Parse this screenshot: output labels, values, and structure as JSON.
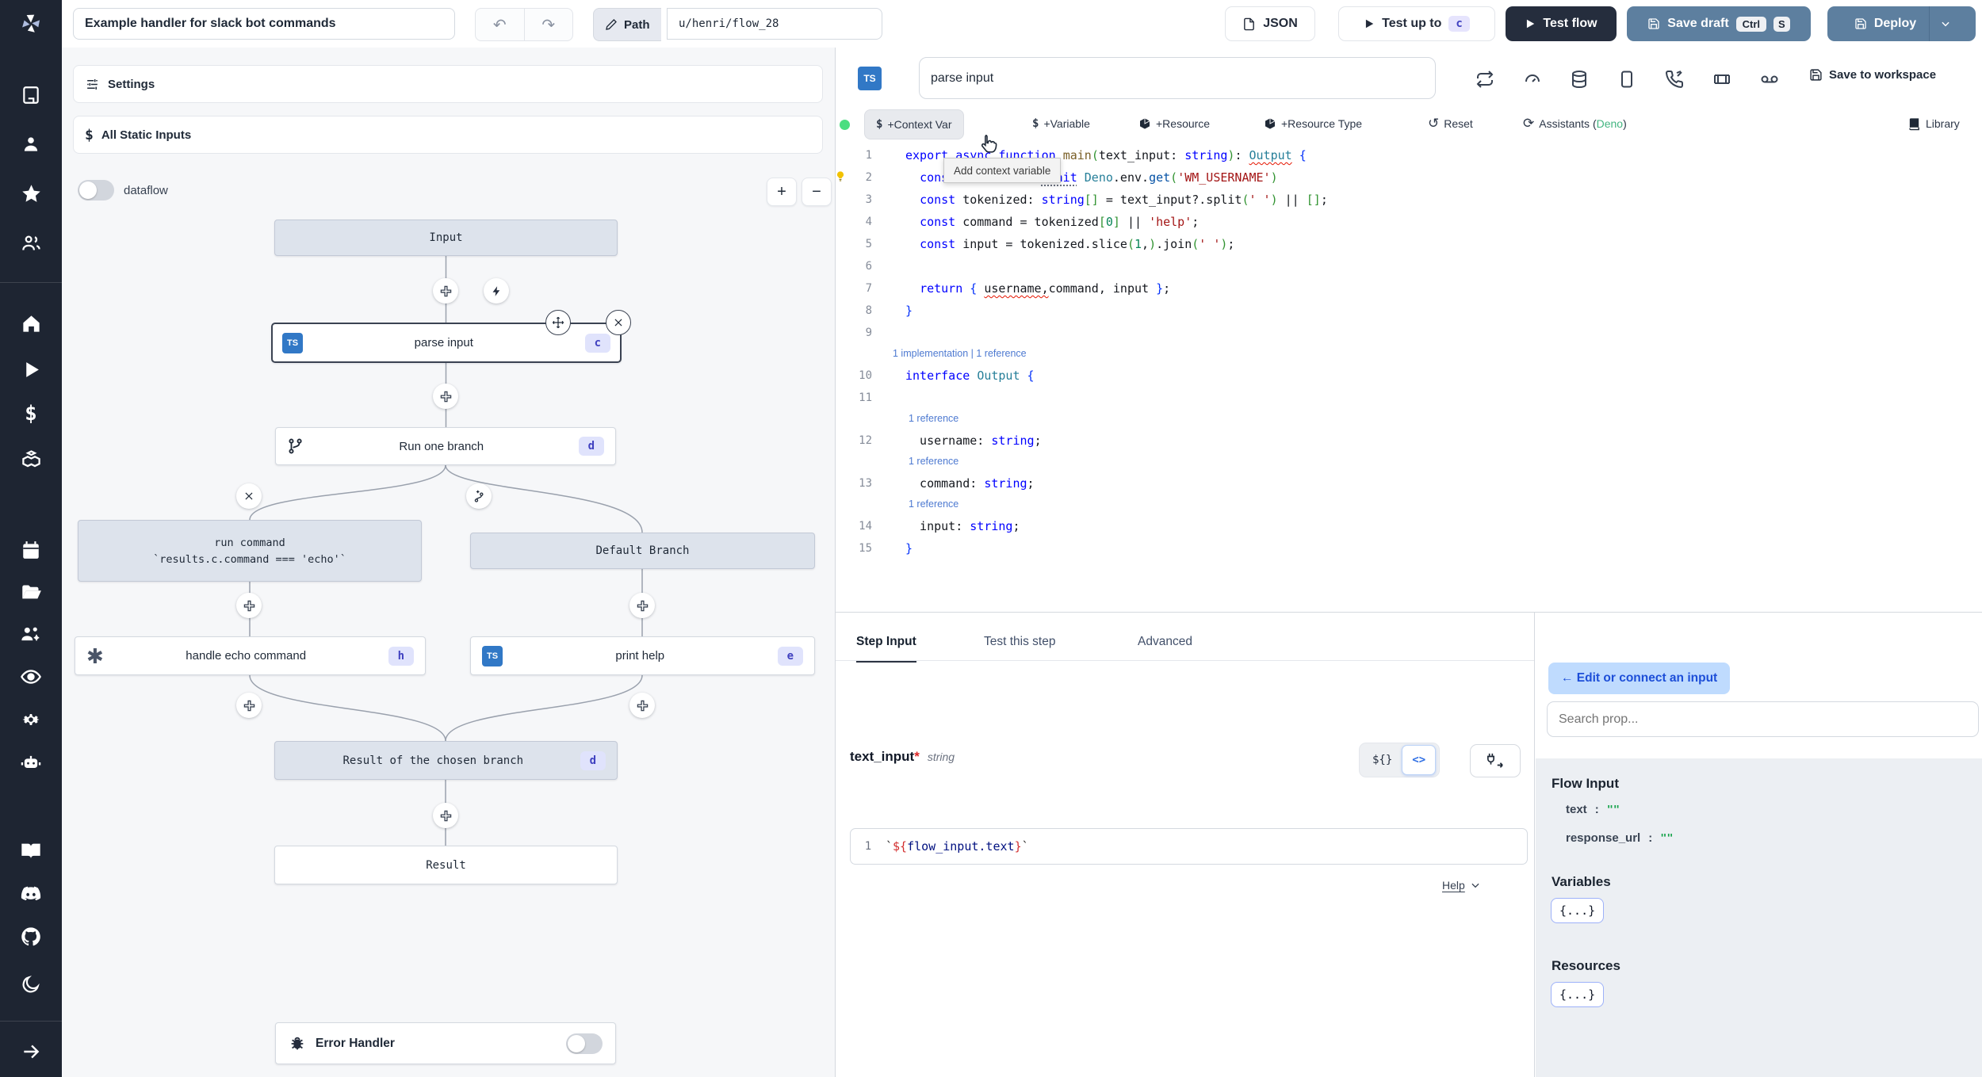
{
  "topbar": {
    "title_value": "Example handler for slack bot commands",
    "undo_icon": "↶",
    "redo_icon": "↷",
    "path_label": "Path",
    "path_value": "u/henri/flow_28",
    "json_label": "JSON",
    "test_up_to_label": "Test up to",
    "test_up_to_step": "c",
    "test_flow_label": "Test flow",
    "save_draft_label": "Save draft",
    "kbd_ctrl": "Ctrl",
    "kbd_s": "S",
    "deploy_label": "Deploy"
  },
  "left_panel": {
    "settings": "Settings",
    "all_static_inputs": "All Static Inputs",
    "dataflow": "dataflow",
    "zoom_in": "+",
    "zoom_out": "−"
  },
  "graph": {
    "nodes": {
      "input": {
        "label": "Input"
      },
      "parse": {
        "label": "parse input",
        "badge": "c",
        "lang": "TS"
      },
      "branch": {
        "label": "Run one branch",
        "badge": "d"
      },
      "run_command": {
        "line1": "run command",
        "line2": "`results.c.command === 'echo'`"
      },
      "default_branch": {
        "label": "Default Branch"
      },
      "handle_echo": {
        "label": "handle echo command",
        "badge": "h",
        "icon_glyph": "✱"
      },
      "print_help": {
        "label": "print help",
        "badge": "e",
        "lang": "TS"
      },
      "result_chosen": {
        "label": "Result of the chosen branch",
        "badge": "d"
      },
      "result": {
        "label": "Result"
      },
      "error_handler": {
        "label": "Error Handler"
      }
    }
  },
  "editor": {
    "step_name": "parse input",
    "save_to_workspace": "Save to workspace",
    "library": "Library",
    "actions": {
      "context_var": "+Context Var",
      "variable": "+Variable",
      "resource": "+Resource",
      "resource_type": "+Resource Type",
      "reset": "Reset",
      "assistants_prefix": "Assistants (",
      "assistants_lang": "Deno",
      "assistants_suffix": ")",
      "dollar_glyph": "$",
      "reset_glyph": "↺",
      "assist_glyph": "⟳"
    },
    "tooltip": "Add context variable",
    "code": [
      {
        "t": "line",
        "n": "1",
        "tokens": [
          [
            "kw",
            "export"
          ],
          [
            "pl",
            " "
          ],
          [
            "kw",
            "async"
          ],
          [
            "pl",
            " "
          ],
          [
            "kw",
            "function"
          ],
          [
            "pl",
            " "
          ],
          [
            "fn",
            "main"
          ],
          [
            "br2",
            "("
          ],
          [
            "pl",
            "text_input"
          ],
          [
            "pl",
            ": "
          ],
          [
            "kw",
            "string"
          ],
          [
            "br2",
            ")"
          ],
          [
            "pl",
            ": "
          ],
          [
            "type sq",
            "Output"
          ],
          [
            "pl",
            " "
          ],
          [
            "br1",
            "{"
          ]
        ]
      },
      {
        "t": "line",
        "n": "2",
        "bulb": true,
        "tokens": [
          [
            "pl",
            "  "
          ],
          [
            "kw",
            "const"
          ],
          [
            "pl",
            " username = "
          ],
          [
            "kw dotted",
            "await"
          ],
          [
            "pl",
            " "
          ],
          [
            "type",
            "Deno"
          ],
          [
            "pl",
            ".env."
          ],
          [
            "mem",
            "get"
          ],
          [
            "br2",
            "("
          ],
          [
            "str",
            "'WM_USERNAME'"
          ],
          [
            "br2",
            ")"
          ]
        ]
      },
      {
        "t": "line",
        "n": "3",
        "tokens": [
          [
            "pl",
            "  "
          ],
          [
            "kw",
            "const"
          ],
          [
            "pl",
            " tokenized: "
          ],
          [
            "kw",
            "string"
          ],
          [
            "br2",
            "[]"
          ],
          [
            "pl",
            " = text_input?.split"
          ],
          [
            "br2",
            "("
          ],
          [
            "str",
            "' '"
          ],
          [
            "br2",
            ")"
          ],
          [
            "pl",
            " || "
          ],
          [
            "br2",
            "[]"
          ],
          [
            "pl",
            ";"
          ]
        ]
      },
      {
        "t": "line",
        "n": "4",
        "tokens": [
          [
            "pl",
            "  "
          ],
          [
            "kw",
            "const"
          ],
          [
            "pl",
            " command = tokenized"
          ],
          [
            "br2",
            "["
          ],
          [
            "num",
            "0"
          ],
          [
            "br2",
            "]"
          ],
          [
            "pl",
            " || "
          ],
          [
            "str",
            "'help'"
          ],
          [
            "pl",
            ";"
          ]
        ]
      },
      {
        "t": "line",
        "n": "5",
        "tokens": [
          [
            "pl",
            "  "
          ],
          [
            "kw",
            "const"
          ],
          [
            "pl",
            " input = tokenized.slice"
          ],
          [
            "br2",
            "("
          ],
          [
            "num",
            "1"
          ],
          [
            "pl",
            ","
          ],
          [
            "br2",
            ")"
          ],
          [
            "pl",
            ".join"
          ],
          [
            "br2",
            "("
          ],
          [
            "str",
            "' '"
          ],
          [
            "br2",
            ")"
          ],
          [
            "pl",
            ";"
          ]
        ]
      },
      {
        "t": "line",
        "n": "6",
        "tokens": []
      },
      {
        "t": "line",
        "n": "7",
        "tokens": [
          [
            "pl",
            "  "
          ],
          [
            "kw",
            "return"
          ],
          [
            "pl",
            " "
          ],
          [
            "br1",
            "{"
          ],
          [
            "pl",
            " "
          ],
          [
            "pl sq",
            "username,"
          ],
          [
            "pl",
            "command, input "
          ],
          [
            "br1",
            "}"
          ],
          [
            "pl",
            ";"
          ]
        ]
      },
      {
        "t": "line",
        "n": "8",
        "tokens": [
          [
            "br1",
            "}"
          ]
        ]
      },
      {
        "t": "line",
        "n": "9",
        "tokens": []
      },
      {
        "t": "lens",
        "ind": 0,
        "text": "1 implementation | 1 reference"
      },
      {
        "t": "line",
        "n": "10",
        "tokens": [
          [
            "kw",
            "interface"
          ],
          [
            "pl",
            " "
          ],
          [
            "type",
            "Output"
          ],
          [
            "pl",
            " "
          ],
          [
            "br1",
            "{"
          ]
        ]
      },
      {
        "t": "line",
        "n": "11",
        "tokens": []
      },
      {
        "t": "lens",
        "ind": 1,
        "text": "1 reference"
      },
      {
        "t": "line",
        "n": "12",
        "tokens": [
          [
            "pl",
            "  username: "
          ],
          [
            "kw",
            "string"
          ],
          [
            "pl",
            ";"
          ]
        ]
      },
      {
        "t": "lens",
        "ind": 1,
        "text": "1 reference"
      },
      {
        "t": "line",
        "n": "13",
        "tokens": [
          [
            "pl",
            "  command: "
          ],
          [
            "kw",
            "string"
          ],
          [
            "pl",
            ";"
          ]
        ]
      },
      {
        "t": "lens",
        "ind": 1,
        "text": "1 reference"
      },
      {
        "t": "line",
        "n": "14",
        "tokens": [
          [
            "pl",
            "  input: "
          ],
          [
            "kw",
            "string"
          ],
          [
            "pl",
            ";"
          ]
        ]
      },
      {
        "t": "line",
        "n": "15",
        "tokens": [
          [
            "br1",
            "}"
          ]
        ]
      }
    ]
  },
  "step_panel": {
    "tabs": [
      "Step Input",
      "Test this step",
      "Advanced"
    ],
    "field": "text_input",
    "required": "*",
    "type": "string",
    "toggle_expr": "${}",
    "toggle_code": "<>",
    "expr_line_no": "1",
    "expr_tokens": [
      [
        "tick",
        "`"
      ],
      [
        "expr",
        "${"
      ],
      [
        "id",
        "flow_input.text"
      ],
      [
        "expr",
        "}"
      ],
      [
        "tick",
        "`"
      ]
    ],
    "help": "Help"
  },
  "right_panel": {
    "edit_connect": "← Edit or connect an input",
    "search_placeholder": "Search prop...",
    "flow_input": "Flow Input",
    "props": [
      {
        "name": "text",
        "sep": ":",
        "value": "\"\""
      },
      {
        "name": "response_url",
        "sep": ":",
        "value": "\"\""
      }
    ],
    "variables": "Variables",
    "resources": "Resources",
    "object_chip": "{...}"
  },
  "colors": {
    "sidebar_bg": "#1e2532",
    "steel_button": "#5d7f9f",
    "dark_button": "#252d3d",
    "badge_bg": "#e0e3fc",
    "badge_text": "#4041c0",
    "ts_blue": "#3178c6",
    "deno_green": "#43b581",
    "status_green": "#4ade80",
    "connect_btn_bg": "#bfdbfe",
    "connect_btn_text": "#1d4ed8"
  }
}
